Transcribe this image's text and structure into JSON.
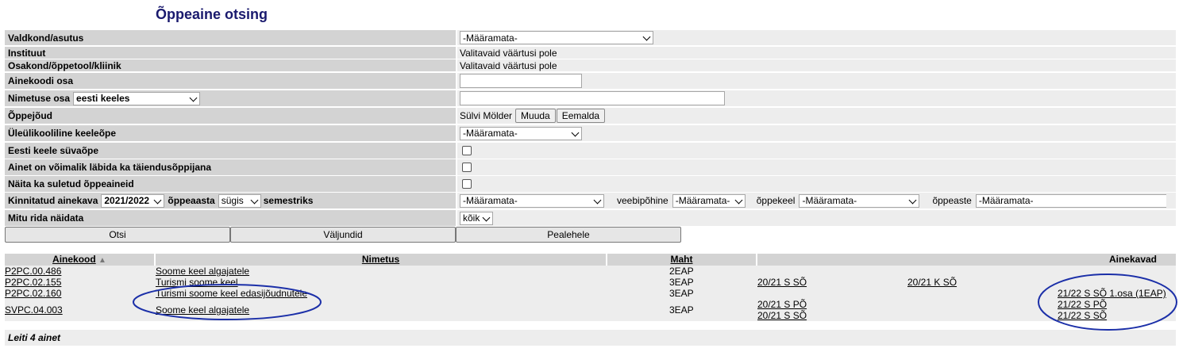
{
  "page": {
    "title": "Õppeaine otsing"
  },
  "filters": {
    "valdkond": {
      "label": "Valdkond/asutus",
      "value": "-Määramata-"
    },
    "instituut": {
      "label": "Instituut",
      "value": "Valitavaid väärtusi pole"
    },
    "osakond": {
      "label": "Osakond/õppetool/kliinik",
      "value": "Valitavaid väärtusi pole"
    },
    "ainekood": {
      "label": "Ainekoodi osa",
      "value": ""
    },
    "nimetus": {
      "label": "Nimetuse osa",
      "lang": "eesti keeles",
      "value": ""
    },
    "oppejoud": {
      "label": "Õppejõud",
      "value": "Sülvi Mölder",
      "muuda": "Muuda",
      "eemalda": "Eemalda"
    },
    "keeleope": {
      "label": "Üleülikooliline keeleõpe",
      "value": "-Määramata-"
    },
    "suvaope": {
      "label": "Eesti keele süvaõpe",
      "checked": false
    },
    "taiendus": {
      "label": "Ainet on võimalik läbida ka täiendusõppijana",
      "checked": false
    },
    "suletud": {
      "label": "Näita ka suletud õppeaineid",
      "checked": false
    },
    "ainekava": {
      "label": "Kinnitatud ainekava",
      "year": "2021/2022",
      "year_suffix": "õppeaasta",
      "semester": "sügis",
      "semester_suffix": "semestriks",
      "value": "-Määramata-",
      "veebi_label": "veebipõhine",
      "veebi_value": "-Määramata-",
      "keel_label": "õppekeel",
      "keel_value": "-Määramata-",
      "aste_label": "õppeaste",
      "aste_value": "-Määramata-"
    },
    "read": {
      "label": "Mitu rida näidata",
      "value": "kõik"
    }
  },
  "buttons": {
    "otsi": "Otsi",
    "valjundid": "Väljundid",
    "pealehele": "Pealehele"
  },
  "results": {
    "headers": {
      "ainekood": "Ainekood",
      "sort_icon": "▲",
      "nimetus": "Nimetus",
      "maht": "Maht",
      "ainekavad": "Ainekavad"
    },
    "rows": [
      {
        "code": "P2PC.00.486",
        "name": "Soome keel algajatele",
        "maht": "2EAP",
        "k1": [],
        "k2": [],
        "k3": []
      },
      {
        "code": "P2PC.02.155",
        "name": "Turismi soome keel",
        "maht": "3EAP",
        "k1": [
          "20/21 S SÕ"
        ],
        "k2": [
          "20/21 K SÕ"
        ],
        "k3": []
      },
      {
        "code": "P2PC.02.160",
        "name": "Turismi soome keel edasijõudnutele",
        "maht": "3EAP",
        "k1": [],
        "k2": [],
        "k3": [
          "21/22 S SÕ 1.osa (1EAP)"
        ]
      },
      {
        "code": "SVPC.04.003",
        "name": "Soome keel algajatele",
        "maht": "3EAP",
        "k1": [
          "20/21 S PÕ",
          "20/21 S SÕ"
        ],
        "k2": [],
        "k3": [
          "21/22 S PÕ",
          "21/22 S SÕ"
        ]
      }
    ],
    "summary": "Leiti 4 ainet"
  },
  "colors": {
    "annotation": "#1b2fa8",
    "title": "#1a1a6e"
  }
}
